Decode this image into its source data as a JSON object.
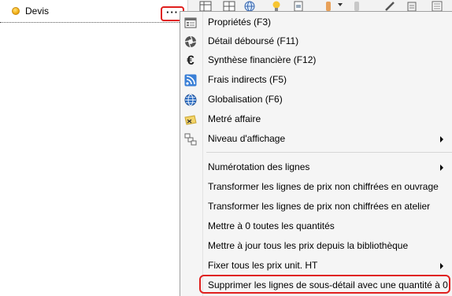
{
  "tree": {
    "root_label": "Devis"
  },
  "dots_button": {
    "label": "···"
  },
  "menu": {
    "items": [
      {
        "label": "Propriétés (F3)",
        "icon": "properties-icon",
        "submenu": false
      },
      {
        "label": "Détail déboursé (F11)",
        "icon": "aperture-icon",
        "submenu": false
      },
      {
        "label": "Synthèse financière (F12)",
        "icon": "euro-icon",
        "submenu": false
      },
      {
        "label": "Frais indirects (F5)",
        "icon": "rss-icon",
        "submenu": false
      },
      {
        "label": "Globalisation (F6)",
        "icon": "globe-icon",
        "submenu": false
      },
      {
        "label": "Metré affaire",
        "icon": "ruler-icon",
        "submenu": false
      },
      {
        "label": "Niveau d'affichage",
        "icon": "levels-icon",
        "submenu": true
      },
      {
        "label": "Numérotation des lignes",
        "icon": "",
        "submenu": true
      },
      {
        "label": "Transformer les lignes de prix non chiffrées en ouvrage",
        "icon": "",
        "submenu": false
      },
      {
        "label": "Transformer les lignes de prix non chiffrées en atelier",
        "icon": "",
        "submenu": false
      },
      {
        "label": "Mettre à 0 toutes les quantités",
        "icon": "",
        "submenu": false
      },
      {
        "label": "Mettre à jour tous les prix depuis la bibliothèque",
        "icon": "",
        "submenu": false
      },
      {
        "label": "Fixer tous les prix unit. HT",
        "icon": "",
        "submenu": true
      },
      {
        "label": "Supprimer les lignes de sous-détail avec une quantité à 0",
        "icon": "",
        "submenu": false
      }
    ]
  },
  "colors": {
    "highlight_border": "#e0201e",
    "menu_bg": "#f5f5f5"
  }
}
